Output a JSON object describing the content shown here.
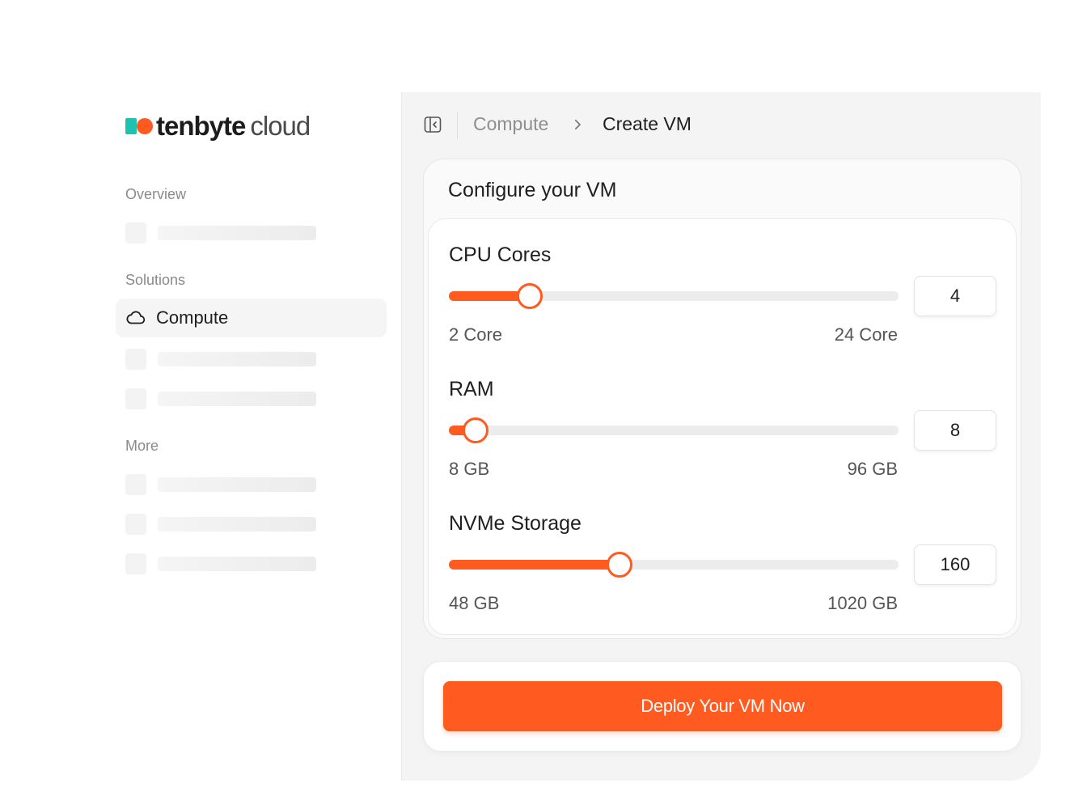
{
  "brand": {
    "name_strong": "tenbyte",
    "name_light": "cloud",
    "colors": {
      "accent": "#ff5a1f",
      "teal": "#1ec2b1"
    }
  },
  "sidebar": {
    "sections": [
      {
        "label": "Overview"
      },
      {
        "label": "Solutions"
      },
      {
        "label": "More"
      }
    ],
    "active_item": {
      "label": "Compute",
      "icon": "cloud-icon"
    }
  },
  "breadcrumb": {
    "toggle_icon": "sidebar-toggle-icon",
    "parent": "Compute",
    "separator_icon": "chevron-right-icon",
    "current": "Create VM"
  },
  "config": {
    "title": "Configure your VM",
    "sliders": [
      {
        "id": "cpu",
        "label": "CPU Cores",
        "min_label": "2 Core",
        "max_label": "24 Core",
        "value": "4",
        "fill_fraction": 0.18
      },
      {
        "id": "ram",
        "label": "RAM",
        "min_label": "8 GB",
        "max_label": "96 GB",
        "value": "8",
        "fill_fraction": 0.06
      },
      {
        "id": "storage",
        "label": "NVMe Storage",
        "min_label": "48 GB",
        "max_label": "1020 GB",
        "value": "160",
        "fill_fraction": 0.38
      }
    ]
  },
  "deploy": {
    "label": "Deploy Your VM Now"
  }
}
